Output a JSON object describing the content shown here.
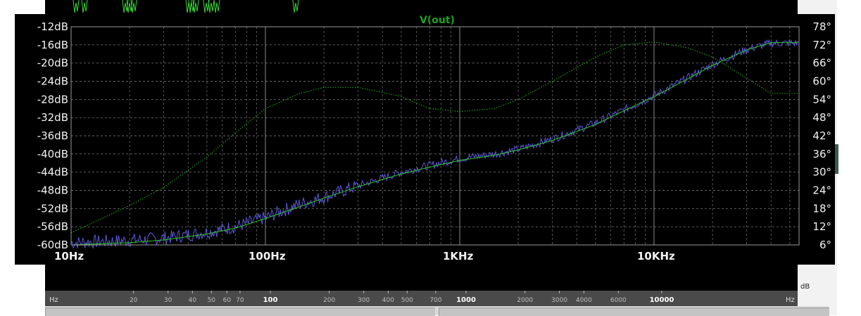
{
  "colors": {
    "magnitude_trace": "#5a5ad8",
    "fit_trace": "#2fc42f",
    "phase_trace": "#229922",
    "top_waveform": "#39d639",
    "grid": "#8a8a8a",
    "title": "#1fa01f"
  },
  "trace_title": "V(out)",
  "left_axis_labels": [
    "-12dB",
    "-16dB",
    "-20dB",
    "-24dB",
    "-28dB",
    "-32dB",
    "-36dB",
    "-40dB",
    "-44dB",
    "-48dB",
    "-52dB",
    "-56dB",
    "-60dB"
  ],
  "right_axis_labels": [
    "78°",
    "72°",
    "66°",
    "60°",
    "54°",
    "48°",
    "42°",
    "36°",
    "30°",
    "24°",
    "18°",
    "12°",
    "6°"
  ],
  "x_axis_labels": [
    {
      "label": "10Hz",
      "hz": 10
    },
    {
      "label": "100Hz",
      "hz": 100
    },
    {
      "label": "1KHz",
      "hz": 1000
    },
    {
      "label": "10KHz",
      "hz": 10000
    }
  ],
  "ruler": {
    "left_label": "Hz",
    "right_label": "Hz",
    "db_label": "dB",
    "ticks": [
      {
        "label": "20",
        "hz": 20
      },
      {
        "label": "30",
        "hz": 30
      },
      {
        "label": "40",
        "hz": 40
      },
      {
        "label": "50",
        "hz": 50
      },
      {
        "label": "60",
        "hz": 60
      },
      {
        "label": "70",
        "hz": 70
      },
      {
        "label": "100",
        "hz": 100,
        "bold": true
      },
      {
        "label": "200",
        "hz": 200
      },
      {
        "label": "300",
        "hz": 300
      },
      {
        "label": "400",
        "hz": 400
      },
      {
        "label": "500",
        "hz": 500
      },
      {
        "label": "700",
        "hz": 700
      },
      {
        "label": "1000",
        "hz": 1000,
        "bold": true
      },
      {
        "label": "2000",
        "hz": 2000
      },
      {
        "label": "3000",
        "hz": 3000
      },
      {
        "label": "4000",
        "hz": 4000
      },
      {
        "label": "6000",
        "hz": 6000
      },
      {
        "label": "10000",
        "hz": 10000,
        "bold": true
      }
    ]
  },
  "chart_data": {
    "type": "line",
    "title": "V(out)",
    "x_scale": "log",
    "xlim_hz": [
      10,
      40000
    ],
    "ylim_db": [
      -60,
      -12
    ],
    "ylim_deg": [
      6,
      78
    ],
    "grid": true,
    "series": [
      {
        "role": "magnitude_fit",
        "x_hz": [
          10,
          20,
          30,
          50,
          70,
          100,
          150,
          200,
          300,
          500,
          700,
          1000,
          1500,
          2000,
          3000,
          5000,
          7000,
          10000,
          15000,
          20000,
          30000,
          40000
        ],
        "y_db": [
          -60,
          -59.5,
          -58.9,
          -57.6,
          -56.3,
          -54.2,
          -51.6,
          -49.7,
          -47.2,
          -44.4,
          -42.9,
          -41.4,
          -40.3,
          -39.1,
          -37,
          -33.5,
          -30.5,
          -27.4,
          -23.4,
          -20.5,
          -17.1,
          -15.5
        ]
      },
      {
        "role": "magnitude_measured",
        "x_hz": [
          10,
          20,
          30,
          50,
          70,
          100,
          150,
          200,
          300,
          500,
          700,
          1000,
          1500,
          2000,
          3000,
          5000,
          7000,
          10000,
          15000,
          20000,
          30000,
          40000
        ],
        "y_db": [
          -59.5,
          -59,
          -58.5,
          -57.2,
          -56,
          -54,
          -51,
          -49.5,
          -47,
          -44,
          -42.5,
          -41,
          -40,
          -39,
          -36.7,
          -33.2,
          -30.3,
          -27.2,
          -23.2,
          -20.3,
          -17,
          -15.6
        ]
      },
      {
        "role": "phase",
        "axis": "right",
        "x_hz": [
          10,
          20,
          30,
          50,
          70,
          100,
          150,
          200,
          300,
          500,
          700,
          1000,
          1500,
          2000,
          3000,
          5000,
          7000,
          10000,
          15000,
          20000,
          30000,
          40000
        ],
        "y_deg": [
          10,
          19,
          25,
          35,
          43,
          51,
          56,
          58,
          58,
          55,
          51,
          50,
          51,
          54,
          60,
          68,
          72,
          73,
          71,
          68,
          61,
          56
        ]
      }
    ]
  }
}
